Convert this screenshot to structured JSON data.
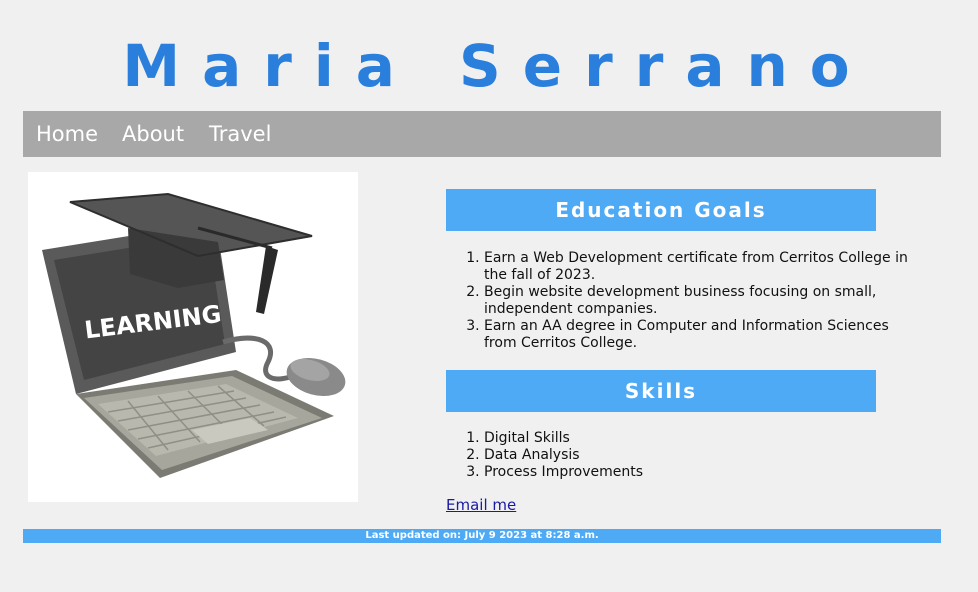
{
  "header": {
    "title": "Maria Serrano"
  },
  "nav": {
    "items": [
      {
        "label": "Home"
      },
      {
        "label": "About"
      },
      {
        "label": "Travel"
      }
    ]
  },
  "image": {
    "screen_text": "LEARNING",
    "colors": {
      "laptop_body": "#8c8c84",
      "screen": "#4a4a4a",
      "cap": "#3c3c3c",
      "mouse": "#8a8a8a"
    }
  },
  "education": {
    "heading": "Education Goals",
    "items": [
      "Earn a Web Development certificate from Cerritos College in the fall of 2023.",
      "Begin website development business focusing on small, independent companies.",
      "Earn an AA degree in Computer and Information Sciences from Cerritos College."
    ]
  },
  "skills": {
    "heading": "Skills",
    "items": [
      "Digital Skills",
      "Data Analysis",
      "Process Improvements"
    ]
  },
  "contact": {
    "email_label": "Email me"
  },
  "footer": {
    "text": "Last updated on: July 9 2023 at 8:28 a.m."
  },
  "colors": {
    "title": "#2a7fdc",
    "nav_background": "#a8a8a8",
    "accent": "#4faaf5",
    "page_background": "#f0f0f0",
    "link": "#1a1aa6"
  }
}
